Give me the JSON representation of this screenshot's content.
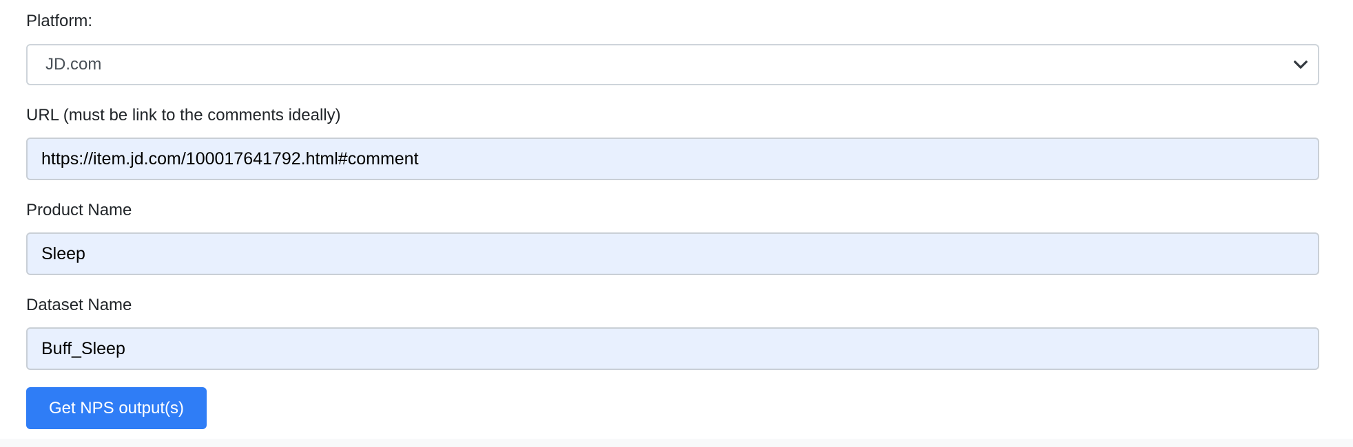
{
  "platform": {
    "label": "Platform:",
    "selected": "JD.com"
  },
  "url": {
    "label": "URL (must be link to the comments ideally)",
    "value": "https://item.jd.com/100017641792.html#comment"
  },
  "product": {
    "label": "Product Name",
    "value": "Sleep"
  },
  "dataset": {
    "label": "Dataset Name",
    "value": "Buff_Sleep"
  },
  "submit": {
    "label": "Get NPS output(s)"
  },
  "colors": {
    "primary": "#2f7df6",
    "autofill_bg": "#e8f0fe",
    "border": "#ced4da"
  },
  "icons": {
    "select_arrow": "chevron-down-icon"
  }
}
